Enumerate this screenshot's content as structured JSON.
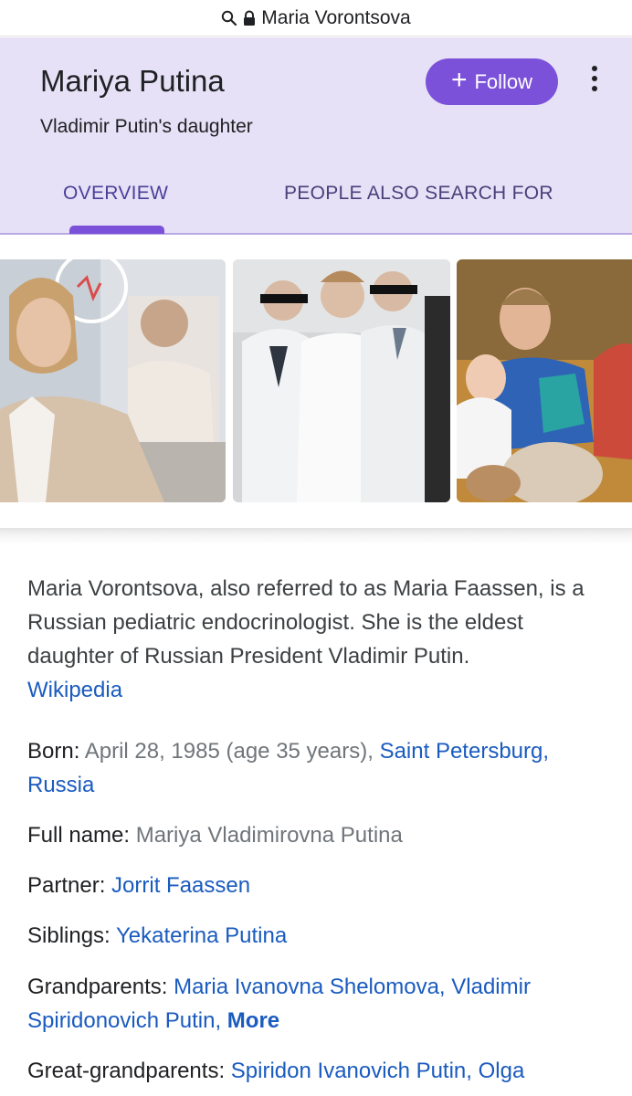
{
  "urlbar": {
    "text": "Maria Vorontsova",
    "search_icon": "search-icon",
    "lock_icon": "lock-icon"
  },
  "panel": {
    "title": "Mariya Putina",
    "subtitle": "Vladimir Putin's daughter",
    "follow_label": "Follow",
    "follow_icon": "plus-icon",
    "more_icon": "more-vert-icon",
    "tabs": [
      {
        "label": "OVERVIEW",
        "active": true
      },
      {
        "label": "PEOPLE ALSO SEARCH FOR",
        "active": false
      }
    ],
    "accent_color": "#7b51d9",
    "header_bg": "#e6e1f6"
  },
  "description": {
    "text": "Maria Vorontsova, also referred to as Maria Faassen, is a Russian pediatric endocrinologist. She is the eldest daughter of Russian President Vladimir Putin.",
    "source_link": "Wikipedia"
  },
  "facts": {
    "born": {
      "label": "Born:",
      "value": "April 28, 1985 (age 35 years),",
      "link": "Saint Petersburg, Russia"
    },
    "full_name": {
      "label": "Full name:",
      "value": "Mariya Vladimirovna Putina"
    },
    "partner": {
      "label": "Partner:",
      "link": "Jorrit Faassen"
    },
    "siblings": {
      "label": "Siblings:",
      "link": "Yekaterina Putina"
    },
    "grandparents": {
      "label": "Grandparents:",
      "link1": "Maria Ivanovna Shelomova",
      "link2": "Vladimir Spiridonovich Putin",
      "more": "More"
    },
    "great_grandparents": {
      "label": "Great-grandparents:",
      "link1": "Spiridon Ivanovich Putin",
      "link2": "Olga"
    }
  },
  "link_color": "#1a5bbf"
}
